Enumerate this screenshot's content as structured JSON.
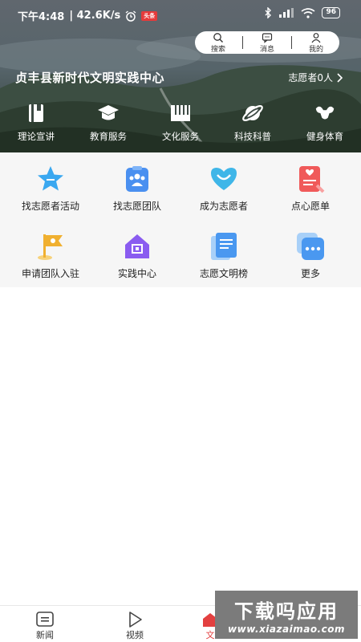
{
  "status_bar": {
    "time": "下午4:48",
    "speed": "| 42.6K/s",
    "app_badge": "头条",
    "battery": "96"
  },
  "toolbar": {
    "search_label": "搜索",
    "messages_label": "消息",
    "mine_label": "我的"
  },
  "hero": {
    "title": "贞丰县新时代文明实践中心",
    "volunteer_count": "志愿者0人"
  },
  "categories": [
    {
      "label": "理论宣讲",
      "icon": "book-icon"
    },
    {
      "label": "教育服务",
      "icon": "graduation-cap-icon"
    },
    {
      "label": "文化服务",
      "icon": "piano-icon"
    },
    {
      "label": "科技科普",
      "icon": "planet-icon"
    },
    {
      "label": "健身体育",
      "icon": "muscle-icon"
    }
  ],
  "services": [
    {
      "label": "找志愿者活动",
      "icon": "star-icon",
      "color": "#3aa8f0"
    },
    {
      "label": "找志愿团队",
      "icon": "team-icon",
      "color": "#4a90f0"
    },
    {
      "label": "成为志愿者",
      "icon": "heart-icon",
      "color": "#3fb6e8"
    },
    {
      "label": "点心愿单",
      "icon": "wish-list-icon",
      "color": "#f05a5a"
    },
    {
      "label": "申请团队入驻",
      "icon": "flag-icon",
      "color": "#f0b030"
    },
    {
      "label": "实践中心",
      "icon": "house-icon",
      "color": "#8a5cf0"
    },
    {
      "label": "志愿文明榜",
      "icon": "document-icon",
      "color": "#4a98f0"
    },
    {
      "label": "更多",
      "icon": "more-icon",
      "color": "#4a98f0"
    }
  ],
  "bottom_nav": {
    "news_label": "新闻",
    "video_label": "视频",
    "third_label": "文"
  },
  "watermark": {
    "title": "下载吗应用",
    "url": "www.xiazaimao.com"
  }
}
